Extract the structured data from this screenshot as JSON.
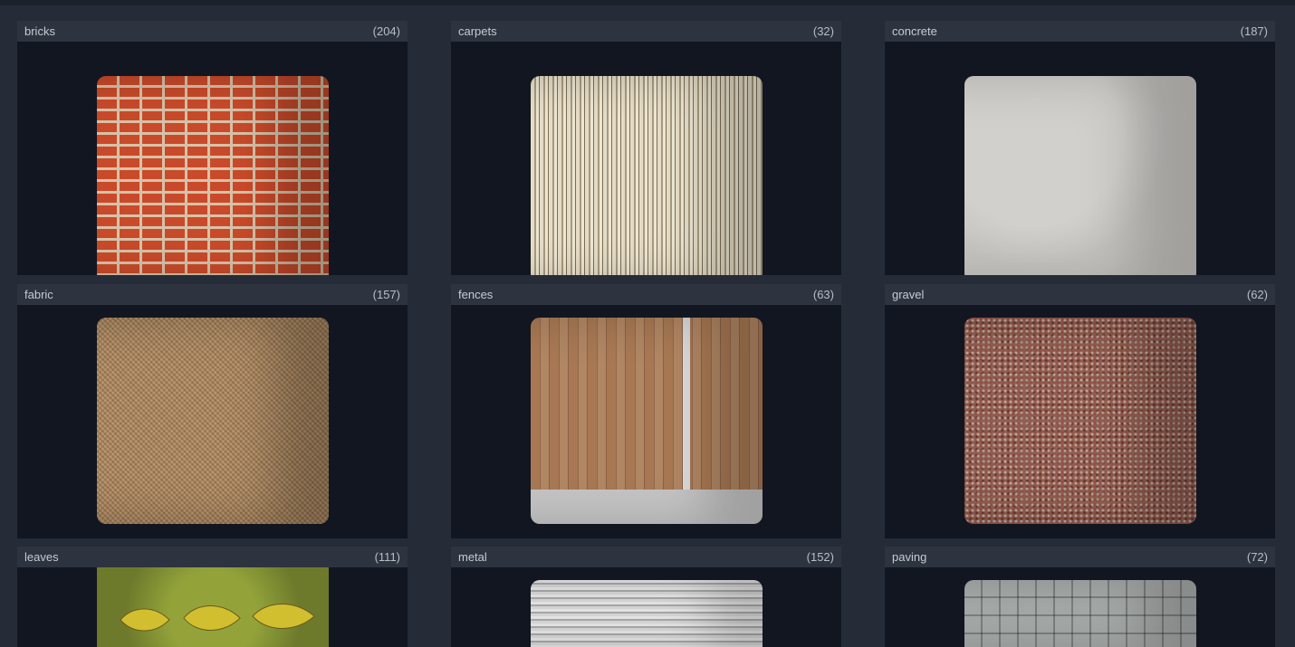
{
  "categories": [
    {
      "name": "bricks",
      "count": "(204)",
      "material": "bricks"
    },
    {
      "name": "carpets",
      "count": "(32)",
      "material": "carpets"
    },
    {
      "name": "concrete",
      "count": "(187)",
      "material": "concrete"
    },
    {
      "name": "fabric",
      "count": "(157)",
      "material": "fabric"
    },
    {
      "name": "fences",
      "count": "(63)",
      "material": "fences"
    },
    {
      "name": "gravel",
      "count": "(62)",
      "material": "gravel"
    },
    {
      "name": "leaves",
      "count": "(111)",
      "material": "leaves"
    },
    {
      "name": "metal",
      "count": "(152)",
      "material": "metal"
    },
    {
      "name": "paving",
      "count": "(72)",
      "material": "paving"
    }
  ]
}
